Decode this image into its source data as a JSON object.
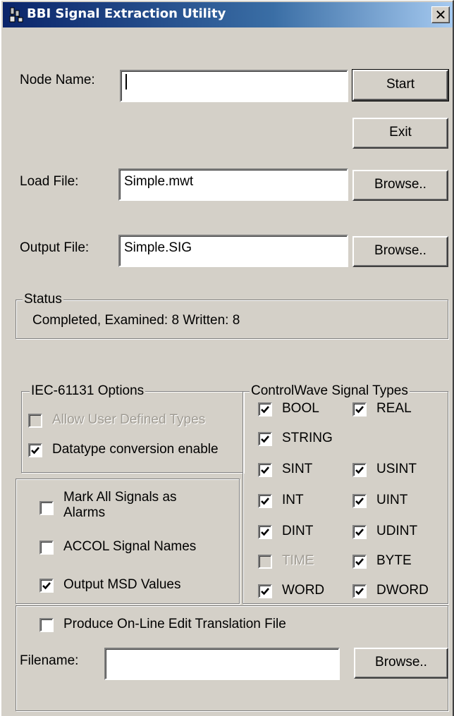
{
  "window": {
    "title": "BBI Signal Extraction Utility",
    "close_glyph": "✕"
  },
  "node_name": {
    "label": "Node Name:",
    "value": ""
  },
  "buttons": {
    "start": "Start",
    "exit": "Exit",
    "browse": "Browse.."
  },
  "load_file": {
    "label": "Load File:",
    "value": "Simple.mwt"
  },
  "output_file": {
    "label": "Output File:",
    "value": "Simple.SIG"
  },
  "status": {
    "legend": "Status",
    "text": "Completed, Examined: 8 Written: 8"
  },
  "iec_options": {
    "legend": "IEC-61131 Options",
    "allow_user_types": {
      "label": "Allow User Defined Types",
      "checked": false,
      "enabled": false
    },
    "datatype_conversion": {
      "label": "Datatype conversion enable",
      "checked": true,
      "enabled": true
    }
  },
  "signal_options": {
    "mark_alarms": {
      "line1": "Mark All Signals as",
      "line2": "Alarms",
      "checked": false
    },
    "accol_names": {
      "label": "ACCOL Signal Names",
      "checked": false
    },
    "output_msd": {
      "label": "Output MSD Values",
      "checked": true
    }
  },
  "signal_types": {
    "legend": "ControlWave Signal Types",
    "bool": {
      "label": "BOOL",
      "checked": true
    },
    "real": {
      "label": "REAL",
      "checked": true
    },
    "string": {
      "label": "STRING",
      "checked": true
    },
    "sint": {
      "label": "SINT",
      "checked": true
    },
    "usint": {
      "label": "USINT",
      "checked": true
    },
    "int": {
      "label": "INT",
      "checked": true
    },
    "uint": {
      "label": "UINT",
      "checked": true
    },
    "dint": {
      "label": "DINT",
      "checked": true
    },
    "udint": {
      "label": "UDINT",
      "checked": true
    },
    "time": {
      "label": "TIME",
      "checked": false,
      "enabled": false
    },
    "byte": {
      "label": "BYTE",
      "checked": true
    },
    "word": {
      "label": "WORD",
      "checked": true
    },
    "dword": {
      "label": "DWORD",
      "checked": true
    }
  },
  "online_edit": {
    "produce": {
      "label": "Produce On-Line Edit Translation File",
      "checked": false
    },
    "filename_label": "Filename:",
    "filename_value": ""
  }
}
